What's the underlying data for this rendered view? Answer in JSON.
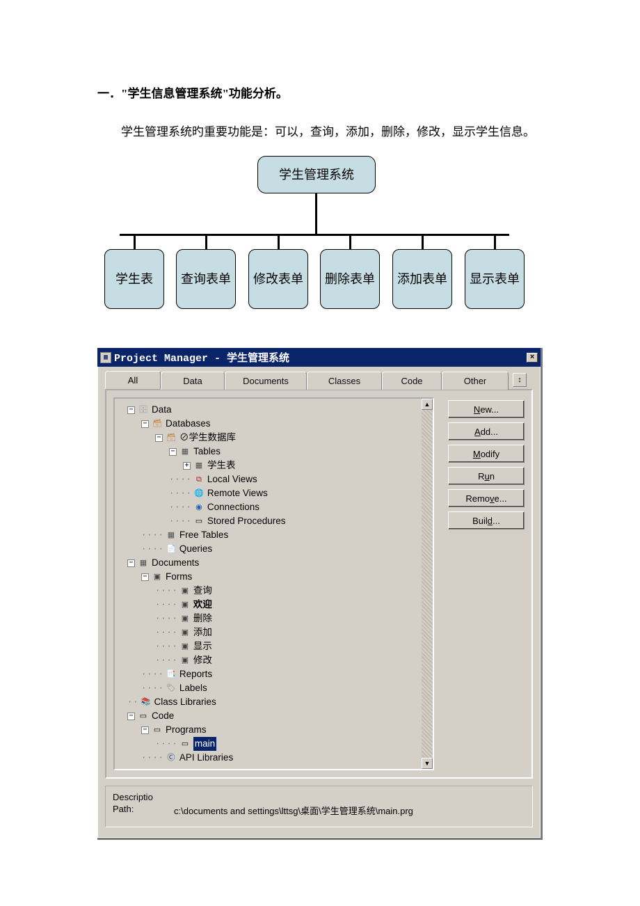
{
  "section_title": "一．\"学生信息管理系统\"功能分析。",
  "intro": "学生管理系统旳重要功能是：可以，查询，添加，删除，修改，显示学生信息。",
  "diagram": {
    "root": "学生管理系统",
    "children": [
      "学生表",
      "查询表单",
      "修改表单",
      "删除表单",
      "添加表单",
      "显示表单"
    ]
  },
  "pm": {
    "title": "Project Manager - 学生管理系统",
    "close": "×",
    "tabs": {
      "all": "All",
      "data": "Data",
      "documents": "Documents",
      "classes": "Classes",
      "code": "Code",
      "other": "Other",
      "arrow": "↕"
    },
    "buttons": {
      "new": "New...",
      "add": "Add...",
      "modify": "Modify",
      "run": "Run",
      "remove": "Remove...",
      "build": "Build..."
    },
    "tree": {
      "data": "Data",
      "databases": "Databases",
      "dbname": "⊘学生数据库",
      "tables": "Tables",
      "table1": "学生表",
      "localviews": "Local Views",
      "remoteviews": "Remote Views",
      "connections": "Connections",
      "storedproc": "Stored Procedures",
      "freetables": "Free Tables",
      "queries": "Queries",
      "documents": "Documents",
      "forms": "Forms",
      "form_query": "查询",
      "form_welcome": "欢迎",
      "form_delete": "删除",
      "form_add": "添加",
      "form_show": "显示",
      "form_modify": "修改",
      "reports": "Reports",
      "labels": "Labels",
      "classlib": "Class Libraries",
      "code": "Code",
      "programs": "Programs",
      "main": "main",
      "apilib": "API Libraries"
    },
    "footer": {
      "desc_label": "Descriptio",
      "path_label": "Path:",
      "path_value": "c:\\documents and settings\\lttsg\\桌面\\学生管理系统\\main.prg"
    }
  }
}
